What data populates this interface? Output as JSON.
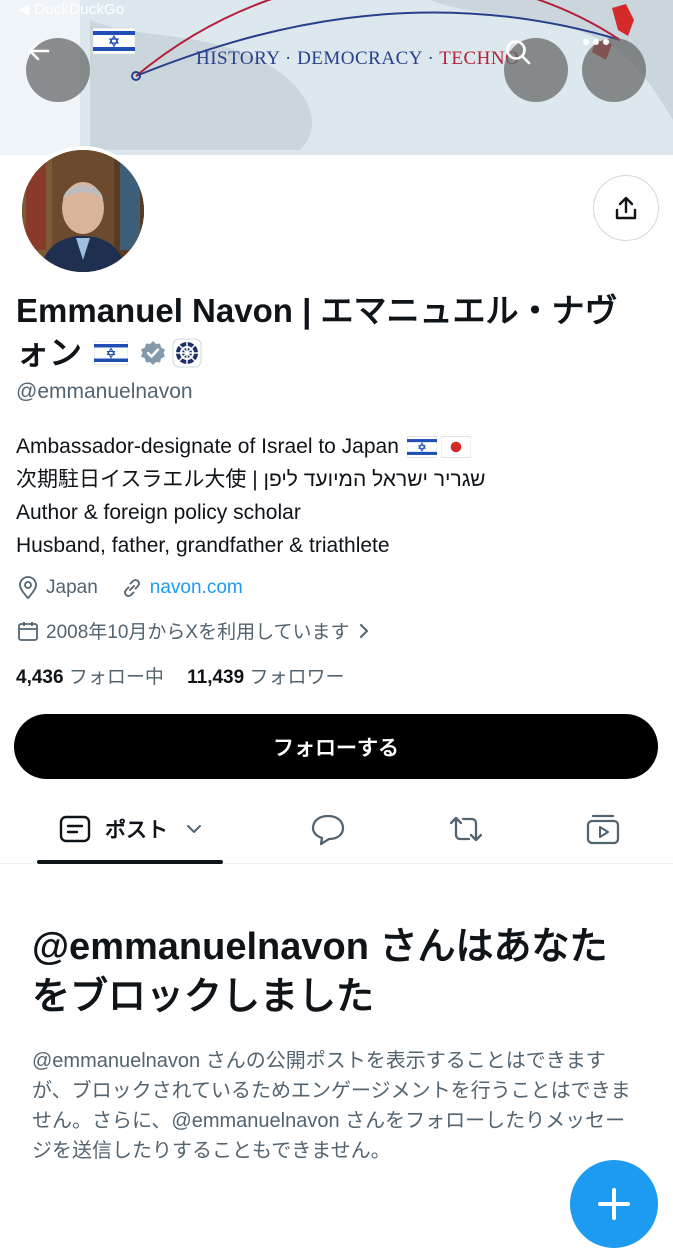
{
  "browser": {
    "back_label": "◀ DuckDuckGo"
  },
  "banner": {
    "text_part1": "HISTORY · DEMOCRACY · ",
    "text_part2": "TECHNO"
  },
  "profile": {
    "name_line1": "Emmanuel Navon | エマニュエル・ナヴ",
    "name_line2": "ォン",
    "handle": "@emmanuelnavon",
    "bio": [
      "Ambassador-designate of Israel to Japan",
      "次期駐日イスラエル大使 | שגריר ישראל המיועד ליפן",
      "Author & foreign policy scholar",
      "Husband, father, grandfather & triathlete"
    ],
    "location": "Japan",
    "website": "navon.com",
    "joined": "2008年10月からXを利用しています",
    "following_count": "4,436",
    "following_label": "フォロー中",
    "followers_count": "11,439",
    "followers_label": "フォロワー"
  },
  "actions": {
    "follow_label": "フォローする"
  },
  "tabs": {
    "posts_label": "ポスト"
  },
  "blocked": {
    "title": "@emmanuelnavon さんはあなたをブロックしました",
    "description": "@emmanuelnavon さんの公開ポストを表示することはできますが、ブロックされているためエンゲージメントを行うことはできません。さらに、@emmanuelnavon さんをフォローしたりメッセージを送信したりすることもできません。"
  },
  "colors": {
    "accent": "#1d9bf0",
    "text": "#0f1419",
    "muted": "#536471",
    "verified": "#829aab"
  }
}
